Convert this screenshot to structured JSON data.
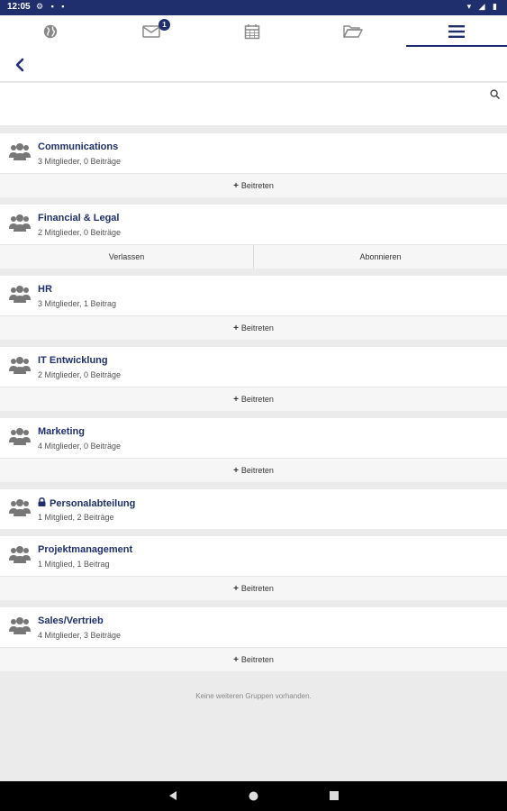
{
  "status_bar": {
    "time": "12:05"
  },
  "tabs": [
    {
      "name": "globe",
      "icon": "globe-icon"
    },
    {
      "name": "messages",
      "icon": "mail-icon",
      "badge": "1"
    },
    {
      "name": "calendar",
      "icon": "calendar-icon"
    },
    {
      "name": "files",
      "icon": "folder-icon"
    },
    {
      "name": "menu",
      "icon": "menu-icon",
      "active": true
    }
  ],
  "search": {
    "placeholder": ""
  },
  "groups": [
    {
      "name": "Communications",
      "meta": "3 Mitglieder, 0 Beiträge",
      "locked": false,
      "actions": [
        "Beitreten"
      ]
    },
    {
      "name": "Financial & Legal",
      "meta": "2 Mitglieder, 0 Beiträge",
      "locked": false,
      "actions": [
        "Verlassen",
        "Abonnieren"
      ]
    },
    {
      "name": "HR",
      "meta": "3 Mitglieder, 1 Beitrag",
      "locked": false,
      "actions": [
        "Beitreten"
      ]
    },
    {
      "name": "IT Entwicklung",
      "meta": "2 Mitglieder, 0 Beiträge",
      "locked": false,
      "actions": [
        "Beitreten"
      ]
    },
    {
      "name": "Marketing",
      "meta": "4 Mitglieder, 0 Beiträge",
      "locked": false,
      "actions": [
        "Beitreten"
      ]
    },
    {
      "name": "Personalabteilung",
      "meta": "1 Mitglied, 2 Beiträge",
      "locked": true,
      "actions": []
    },
    {
      "name": "Projektmanagement",
      "meta": "1 Mitglied, 1 Beitrag",
      "locked": false,
      "actions": [
        "Beitreten"
      ]
    },
    {
      "name": "Sales/Vertrieb",
      "meta": "4 Mitglieder, 3 Beiträge",
      "locked": false,
      "actions": [
        "Beitreten"
      ]
    }
  ],
  "footer_note": "Keine weiteren Gruppen vorhanden.",
  "colors": {
    "primary": "#1f2f6e",
    "background": "#ebebeb"
  }
}
